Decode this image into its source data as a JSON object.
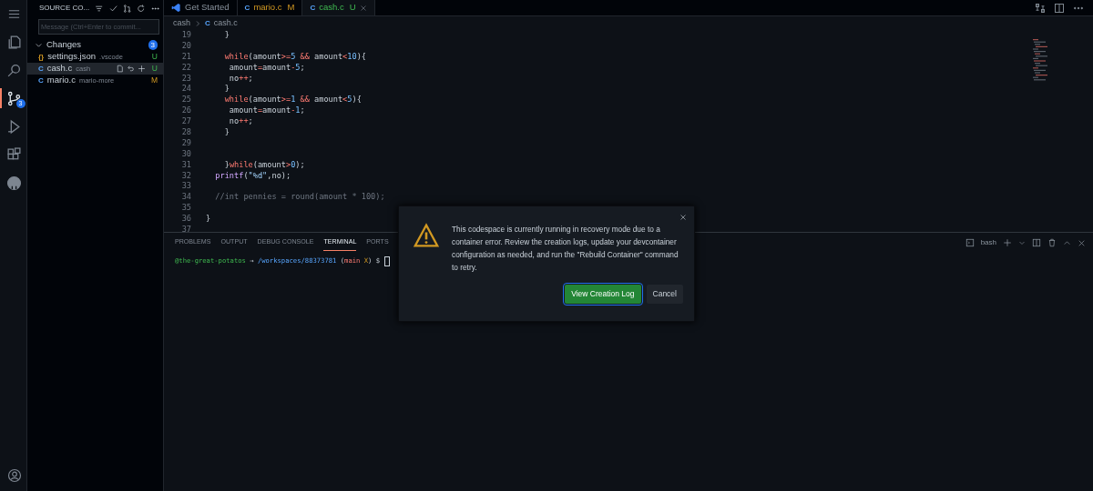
{
  "activity_bar": {
    "items": [
      {
        "kind": "files",
        "selected": false
      },
      {
        "kind": "search",
        "selected": false
      },
      {
        "kind": "scm",
        "selected": true,
        "badge": "3"
      },
      {
        "kind": "run",
        "selected": false
      },
      {
        "kind": "extensions",
        "selected": false
      },
      {
        "kind": "github",
        "selected": false
      }
    ]
  },
  "sidebar": {
    "title": "SOURCE CO...",
    "message": {
      "placeholder": "Message (Ctrl+Enter to commit..."
    },
    "section": {
      "label": "Changes",
      "expanded": true,
      "count": "3"
    },
    "files": [
      {
        "glyph": "{}",
        "name": "settings.json",
        "folder": ".vscode",
        "status": "U",
        "kind": "untracked",
        "selected": false
      },
      {
        "glyph": "C",
        "name": "cash.c",
        "folder": "cash",
        "status": "U",
        "kind": "untracked",
        "selected": true
      },
      {
        "glyph": "C",
        "name": "mario.c",
        "folder": "mario-more",
        "status": "M",
        "kind": "modified",
        "selected": false
      }
    ]
  },
  "tabs": [
    {
      "label": "Get Started",
      "kind": "welcome",
      "selected": false
    },
    {
      "glyph": "C",
      "label": "mario.c",
      "status": "M",
      "kind": "modified",
      "selected": false
    },
    {
      "glyph": "C",
      "label": "cash.c",
      "status": "U",
      "kind": "untracked",
      "selected": true
    }
  ],
  "breadcrumb": [
    {
      "label": "cash"
    },
    {
      "glyph": "C",
      "label": "cash.c"
    }
  ],
  "code": [
    {
      "n": "19",
      "tokens": [
        {
          "t": "    }",
          "kind": "tx"
        }
      ]
    },
    {
      "n": "20"
    },
    {
      "n": "21",
      "tokens": [
        {
          "t": "    while",
          "kind": "kw"
        },
        {
          "t": "(amount",
          "kind": "tx"
        },
        {
          "t": ">=",
          "kind": "op"
        },
        {
          "t": "5 ",
          "kind": "num"
        },
        {
          "t": "&&",
          "kind": "op"
        },
        {
          "t": " amount",
          "kind": "tx"
        },
        {
          "t": "<",
          "kind": "op"
        },
        {
          "t": "10",
          "kind": "num"
        },
        {
          "t": "){",
          "kind": "tx"
        }
      ]
    },
    {
      "n": "22",
      "tokens": [
        {
          "t": "     amount",
          "kind": "tx"
        },
        {
          "t": "=",
          "kind": "op"
        },
        {
          "t": "amount",
          "kind": "tx"
        },
        {
          "t": "-",
          "kind": "op"
        },
        {
          "t": "5",
          "kind": "num"
        },
        {
          "t": ";",
          "kind": "tx"
        }
      ]
    },
    {
      "n": "23",
      "tokens": [
        {
          "t": "     no",
          "kind": "tx"
        },
        {
          "t": "++",
          "kind": "op"
        },
        {
          "t": ";",
          "kind": "tx"
        }
      ]
    },
    {
      "n": "24",
      "tokens": [
        {
          "t": "    }",
          "kind": "tx"
        }
      ]
    },
    {
      "n": "25",
      "tokens": [
        {
          "t": "    while",
          "kind": "kw"
        },
        {
          "t": "(amount",
          "kind": "tx"
        },
        {
          "t": ">=",
          "kind": "op"
        },
        {
          "t": "1 ",
          "kind": "num"
        },
        {
          "t": "&&",
          "kind": "op"
        },
        {
          "t": " amount",
          "kind": "tx"
        },
        {
          "t": "<",
          "kind": "op"
        },
        {
          "t": "5",
          "kind": "num"
        },
        {
          "t": "){",
          "kind": "tx"
        }
      ]
    },
    {
      "n": "26",
      "tokens": [
        {
          "t": "     amount",
          "kind": "tx"
        },
        {
          "t": "=",
          "kind": "op"
        },
        {
          "t": "amount",
          "kind": "tx"
        },
        {
          "t": "-",
          "kind": "op"
        },
        {
          "t": "1",
          "kind": "num"
        },
        {
          "t": ";",
          "kind": "tx"
        }
      ]
    },
    {
      "n": "27",
      "tokens": [
        {
          "t": "     no",
          "kind": "tx"
        },
        {
          "t": "++",
          "kind": "op"
        },
        {
          "t": ";",
          "kind": "tx"
        }
      ]
    },
    {
      "n": "28",
      "tokens": [
        {
          "t": "    }",
          "kind": "tx"
        }
      ]
    },
    {
      "n": "29"
    },
    {
      "n": "30"
    },
    {
      "n": "31",
      "tokens": [
        {
          "t": "    }",
          "kind": "tx"
        },
        {
          "t": "while",
          "kind": "kw"
        },
        {
          "t": "(amount",
          "kind": "tx"
        },
        {
          "t": ">",
          "kind": "op"
        },
        {
          "t": "0",
          "kind": "num"
        },
        {
          "t": ");",
          "kind": "tx"
        }
      ]
    },
    {
      "n": "32",
      "tokens": [
        {
          "t": "  printf",
          "kind": "fn"
        },
        {
          "t": "(",
          "kind": "tx"
        },
        {
          "t": "\"%d\"",
          "kind": "str"
        },
        {
          "t": ",no);",
          "kind": "tx"
        }
      ]
    },
    {
      "n": "33"
    },
    {
      "n": "34",
      "tokens": [
        {
          "t": "  //int pennies = round(amount * 100);",
          "kind": "cm"
        }
      ]
    },
    {
      "n": "35"
    },
    {
      "n": "36",
      "tokens": [
        {
          "t": "}",
          "kind": "tx"
        }
      ]
    },
    {
      "n": "37"
    }
  ],
  "panel": {
    "tabs": [
      {
        "label": "PROBLEMS",
        "selected": false
      },
      {
        "label": "OUTPUT",
        "selected": false
      },
      {
        "label": "DEBUG CONSOLE",
        "selected": false
      },
      {
        "label": "TERMINAL",
        "selected": true
      },
      {
        "label": "PORTS",
        "selected": false
      }
    ],
    "shell": "bash",
    "prompt": [
      {
        "t": "@the-great-potatos",
        "kind": "user"
      },
      {
        "t": " → ",
        "kind": "arrow"
      },
      {
        "t": "/workspaces/88373781",
        "kind": "path"
      },
      {
        "t": " (",
        "kind": "plain"
      },
      {
        "t": "main",
        "kind": "branch"
      },
      {
        "t": " X",
        "kind": "dirty"
      },
      {
        "t": ") $ ",
        "kind": "plain"
      }
    ]
  },
  "dialog": {
    "message": "This codespace is currently running in recovery mode due to a container error. Review the creation logs, update your devcontainer configuration as needed, and run the \"Rebuild Container\" command to retry.",
    "buttons": [
      {
        "label": "View Creation Log",
        "kind": "primary"
      },
      {
        "label": "Cancel",
        "kind": "secondary"
      }
    ]
  }
}
